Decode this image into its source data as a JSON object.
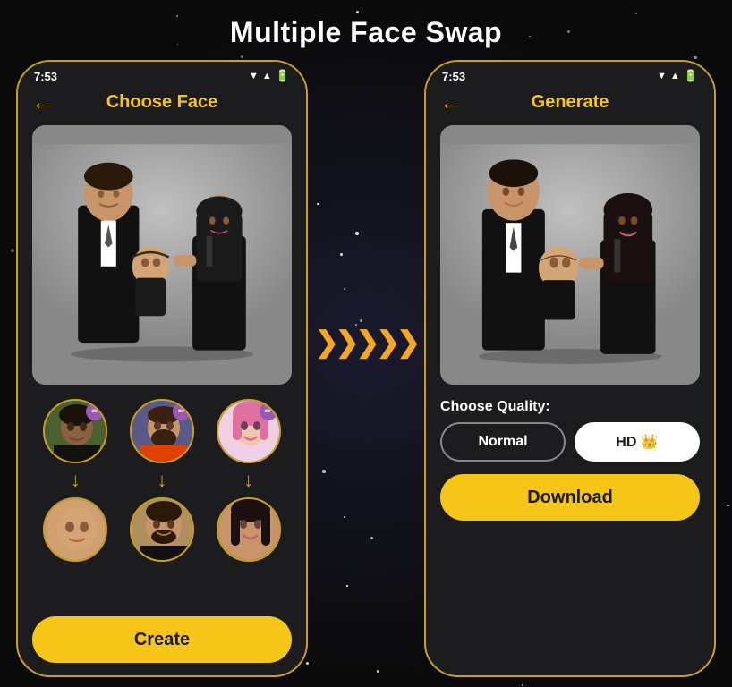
{
  "page": {
    "title": "Multiple Face Swap",
    "background": "#0a0a0a"
  },
  "left_phone": {
    "status_bar": {
      "time": "7:53"
    },
    "nav": {
      "back_icon": "←",
      "title": "Choose Face"
    },
    "face_pairs": [
      {
        "source_face": "soccer-player-1",
        "target_face": "baby",
        "edit_icon": "✏"
      },
      {
        "source_face": "soccer-player-2",
        "target_face": "man",
        "edit_icon": "✏"
      },
      {
        "source_face": "woman-pink",
        "target_face": "woman",
        "edit_icon": "✏"
      }
    ],
    "create_button": "Create"
  },
  "right_phone": {
    "status_bar": {
      "time": "7:53"
    },
    "nav": {
      "back_icon": "←",
      "title": "Generate"
    },
    "quality": {
      "label": "Choose Quality:",
      "normal_label": "Normal",
      "hd_label": "HD 👑"
    },
    "download_button": "Download"
  },
  "arrow": "❯❯❯❯❯"
}
